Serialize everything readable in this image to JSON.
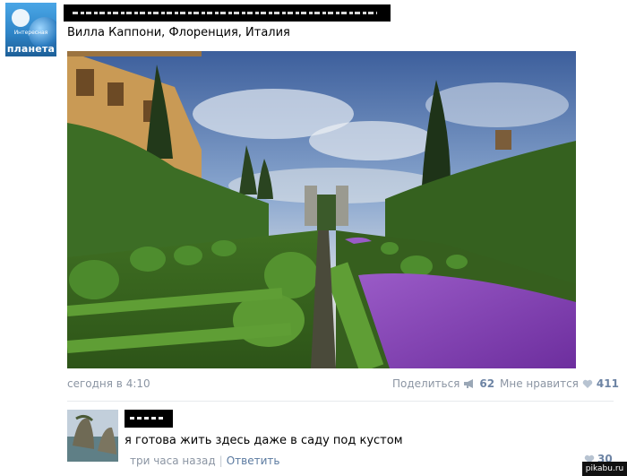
{
  "group": {
    "avatar_caption": "Интересная",
    "avatar_brand": "планета"
  },
  "post": {
    "title": "Вилла Каппони, Флоренция, Италия",
    "time": "сегодня в 4:10",
    "share_label": "Поделиться",
    "share_count": "62",
    "like_label": "Мне нравится",
    "like_count": "411"
  },
  "comment": {
    "text": "я готова жить здесь даже в саду под кустом",
    "time": "три часа назад",
    "separator": "|",
    "reply_label": "Ответить",
    "like_count": "30"
  },
  "watermark": "pikabu.ru",
  "colors": {
    "meta_gray": "#8b95a3",
    "link_blue": "#5b7aa0",
    "count_blue": "#6d84a4",
    "divider": "#e7eaed"
  },
  "icons": {
    "share": "megaphone-icon",
    "like": "heart-icon"
  }
}
